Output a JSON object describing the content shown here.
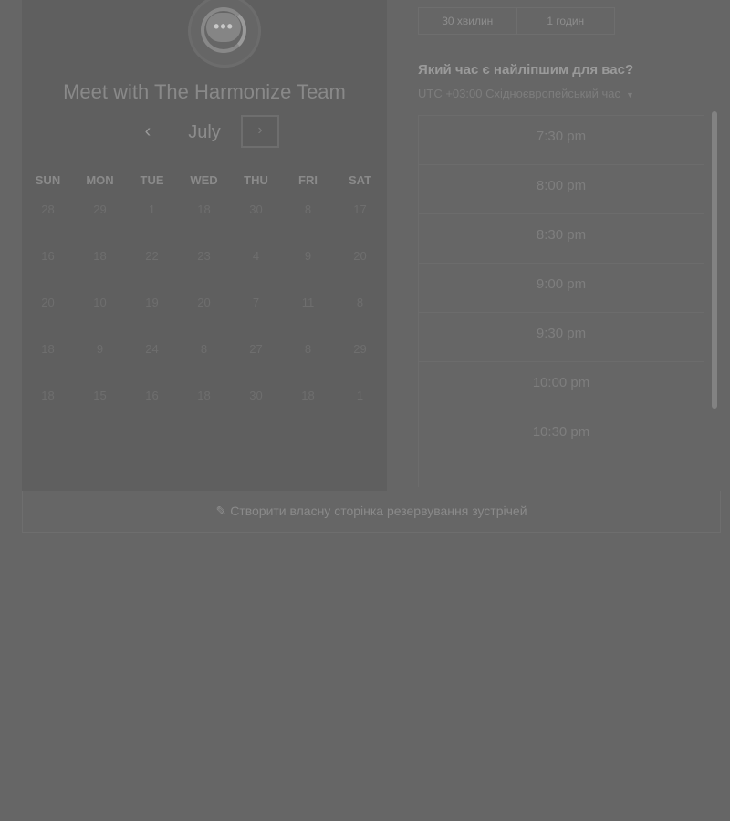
{
  "booking": {
    "title": "Meet with The Harmonize Team",
    "logo_icon": "chat-bubble-icon",
    "calendar": {
      "month": "July",
      "prev_icon": "‹",
      "next_icon": "›",
      "weekdays": [
        "SUN",
        "MON",
        "TUE",
        "WED",
        "THU",
        "FRI",
        "SAT"
      ],
      "weeks": [
        [
          "28",
          "29",
          "1",
          "18",
          "30",
          "8",
          "17"
        ],
        [
          "16",
          "18",
          "22",
          "23",
          "4",
          "9",
          "20"
        ],
        [
          "20",
          "10",
          "19",
          "20",
          "7",
          "11",
          "8"
        ],
        [
          "18",
          "9",
          "24",
          "8",
          "27",
          "8",
          "29"
        ],
        [
          "18",
          "15",
          "16",
          "18",
          "30",
          "18",
          "1"
        ]
      ]
    }
  },
  "durations": [
    "30 хвилин",
    "1 годин"
  ],
  "time_question": "Який час є найліпшим для вас?",
  "timezone": "UTC +03:00 Східноєвропейський час",
  "slots": [
    "7:30 pm",
    "8:00 pm",
    "8:30 pm",
    "9:00 pm",
    "9:30 pm",
    "10:00 pm",
    "10:30 pm"
  ],
  "footer_link": "Створити власну сторінка резервування зустрічей",
  "colors": {
    "backdrop": "#666666",
    "panel": "#5f5f5f"
  }
}
